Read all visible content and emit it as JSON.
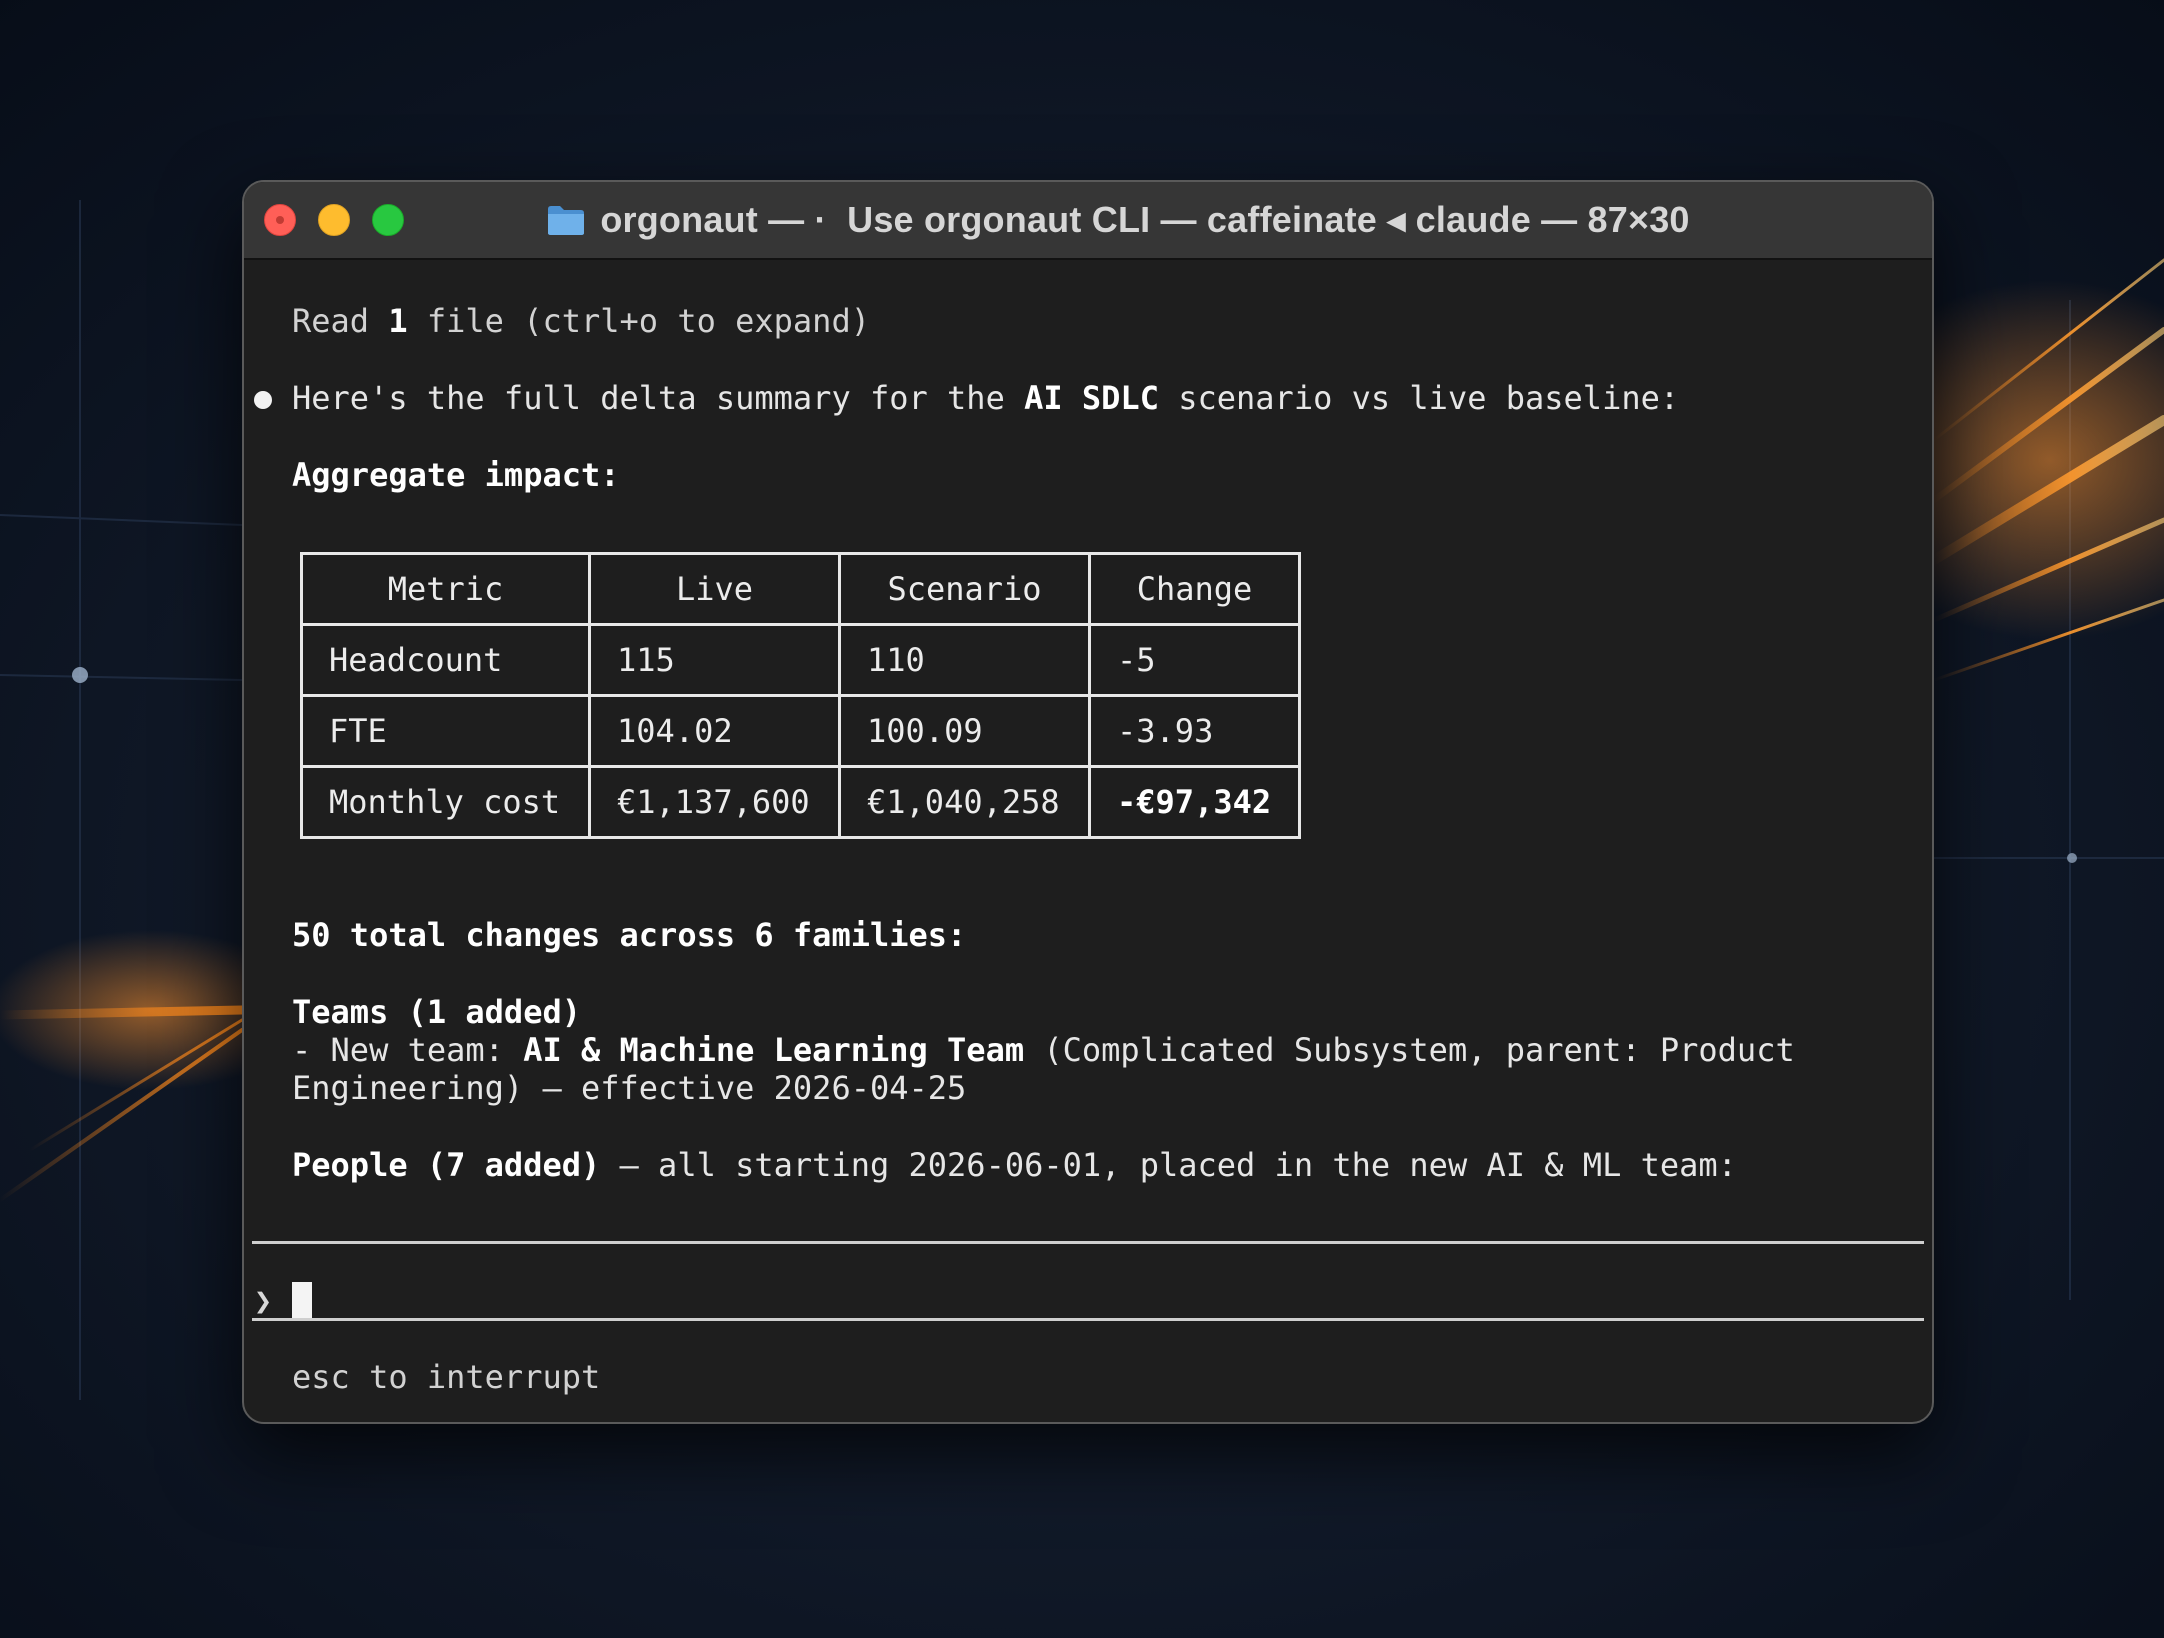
{
  "window": {
    "title_app": "orgonaut",
    "title_rest": "Use orgonaut CLI — caffeinate ◂ claude — 87×30",
    "icon": "folder-icon"
  },
  "terminal": {
    "read_line_prefix": "Read ",
    "read_line_count": "1",
    "read_line_suffix": " file (ctrl+o to expand)",
    "summary_prefix": "Here's the full delta summary for the ",
    "summary_bold": "AI SDLC",
    "summary_suffix": " scenario vs live baseline:",
    "aggregate_heading": "Aggregate impact:",
    "table": {
      "headers": [
        "Metric",
        "Live",
        "Scenario",
        "Change"
      ],
      "rows": [
        [
          "Headcount",
          "115",
          "110",
          "-5"
        ],
        [
          "FTE",
          "104.02",
          "100.09",
          "-3.93"
        ],
        [
          "Monthly cost",
          "€1,137,600",
          "€1,040,258",
          "-€97,342"
        ]
      ]
    },
    "total_changes": "50 total changes across 6 families:",
    "teams_heading": "Teams (1 added)",
    "teams_line1_prefix": "- New team: ",
    "teams_line1_bold": "AI & Machine Learning Team",
    "teams_line1_suffix": " (Complicated Subsystem, parent: Product",
    "teams_line2": "Engineering) — effective 2026-04-25",
    "people_bold": "People (7 added)",
    "people_suffix": " — all starting 2026-06-01, placed in the new AI & ML team:",
    "prompt_symbol": "❯",
    "footer_hint": "esc to interrupt"
  },
  "colors": {
    "close": "#ff5f57",
    "minimize": "#febc2e",
    "maximize": "#28c840",
    "terminal_bg": "#1e1e1e",
    "titlebar_bg": "#363636"
  }
}
